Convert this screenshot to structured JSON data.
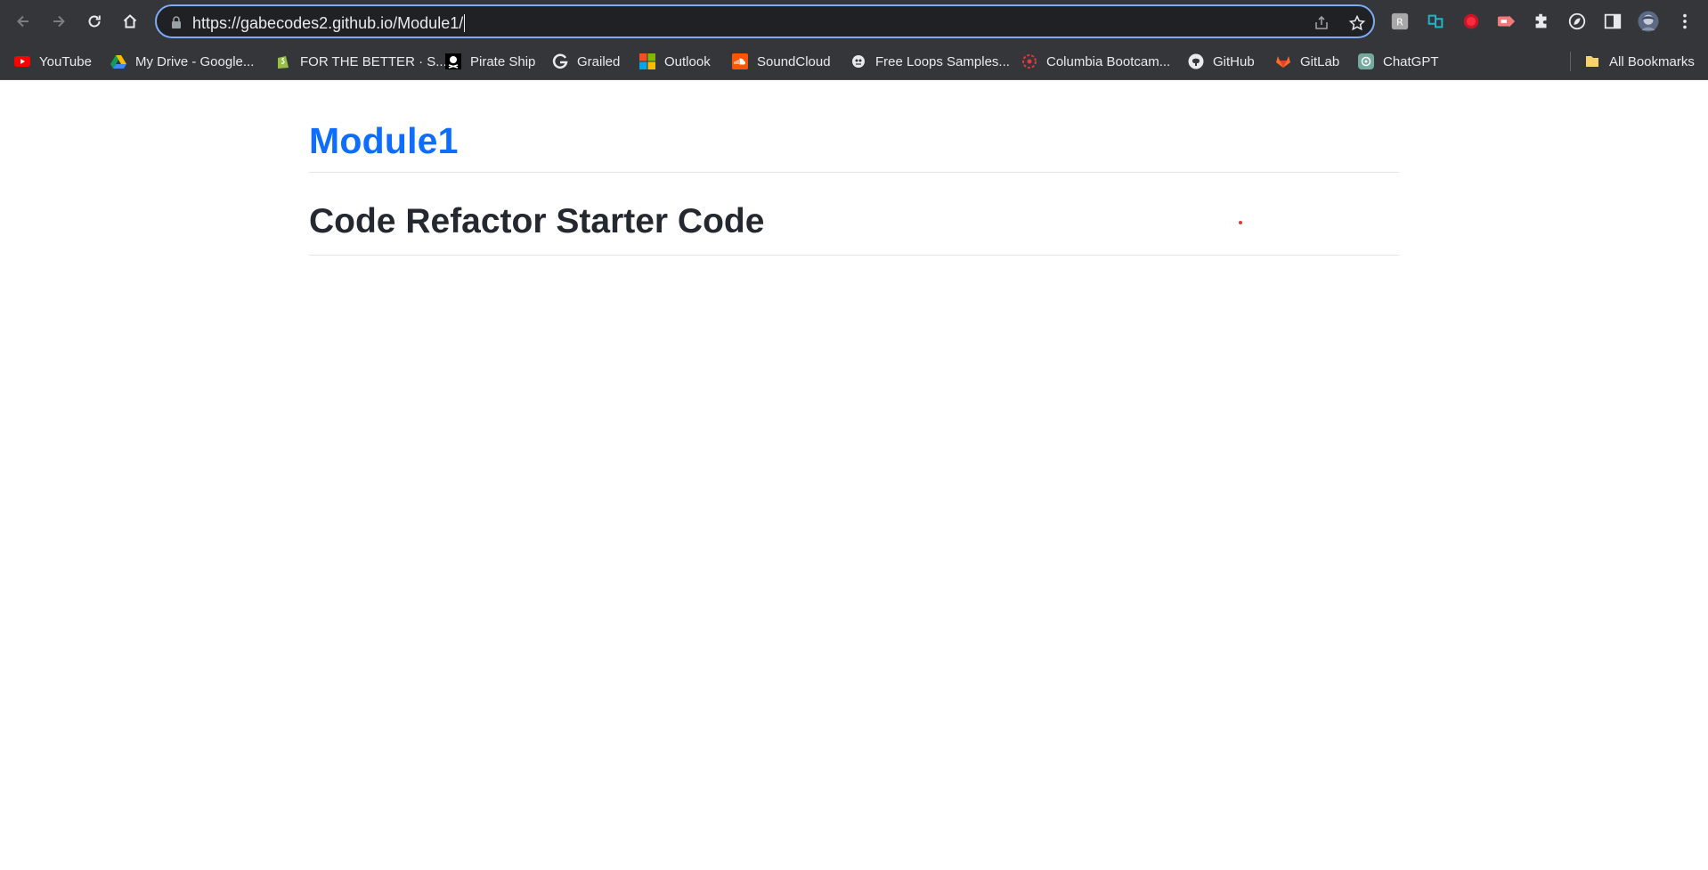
{
  "browser": {
    "url": "https://gabecodes2.github.io/Module1/",
    "nav": {
      "back_icon": "arrow-left-icon",
      "forward_icon": "arrow-right-icon",
      "reload_icon": "reload-icon",
      "home_icon": "home-icon"
    },
    "omnibox_icons": [
      "lock-icon",
      "share-icon",
      "star-icon"
    ],
    "extensions": [
      "extension-grey-icon",
      "extension-teal-icon",
      "record-icon",
      "extension-arrow-icon",
      "puzzle-icon",
      "leaf-icon",
      "side-panel-icon",
      "avatar",
      "kebab-menu-icon"
    ]
  },
  "bookmarks": {
    "items": [
      {
        "label": "YouTube",
        "icon": "youtube-icon"
      },
      {
        "label": "My Drive - Google...",
        "icon": "google-drive-icon"
      },
      {
        "label": "FOR THE BETTER · S...",
        "icon": "shopify-icon"
      },
      {
        "label": "Pirate Ship",
        "icon": "pirate-ship-icon"
      },
      {
        "label": "Grailed",
        "icon": "grailed-icon"
      },
      {
        "label": "Outlook",
        "icon": "microsoft-icon"
      },
      {
        "label": "SoundCloud",
        "icon": "soundcloud-icon"
      },
      {
        "label": "Free Loops Samples...",
        "icon": "free-loops-icon"
      },
      {
        "label": "Columbia Bootcam...",
        "icon": "columbia-icon"
      },
      {
        "label": "GitHub",
        "icon": "github-icon"
      },
      {
        "label": "GitLab",
        "icon": "gitlab-icon"
      },
      {
        "label": "ChatGPT",
        "icon": "chatgpt-icon"
      }
    ],
    "all_bookmarks": {
      "label": "All Bookmarks",
      "icon": "folder-icon"
    }
  },
  "page": {
    "site_title": "Module1",
    "heading": "Code Refactor Starter Code"
  },
  "colors": {
    "toolbar_bg": "#35363a",
    "omnibox_bg": "#202124",
    "omnibox_focus": "#7cacf8",
    "link_blue": "#0d6efd",
    "heading_text": "#24292f"
  }
}
